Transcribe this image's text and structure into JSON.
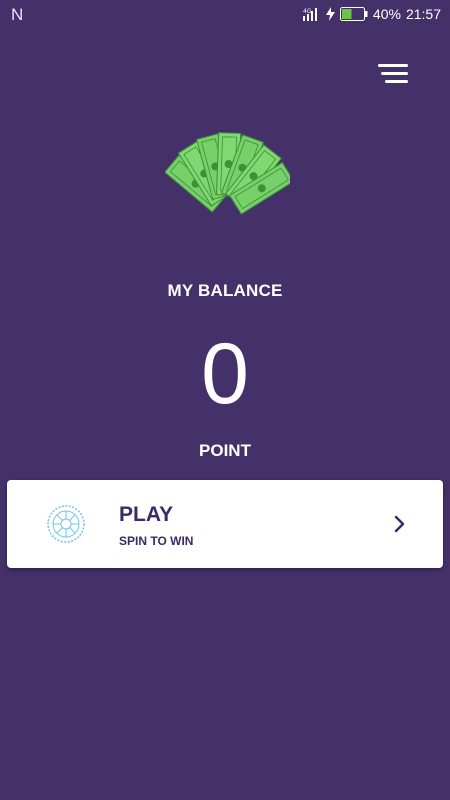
{
  "status_bar": {
    "notification": "N",
    "battery": "40%",
    "time": "21:57"
  },
  "colors": {
    "background": "#45316a",
    "card": "#ffffff",
    "card_text": "#3b2a63",
    "battery_fill": "#6cc24a"
  },
  "icons": {
    "menu": "menu-icon",
    "money": "money-icon",
    "wheel": "wheel-icon",
    "chevron": "chevron-right-icon"
  },
  "balance": {
    "label": "MY BALANCE",
    "value": "0",
    "unit": "POINT"
  },
  "play_card": {
    "title": "PLAY",
    "subtitle": "SPIN TO WIN"
  }
}
